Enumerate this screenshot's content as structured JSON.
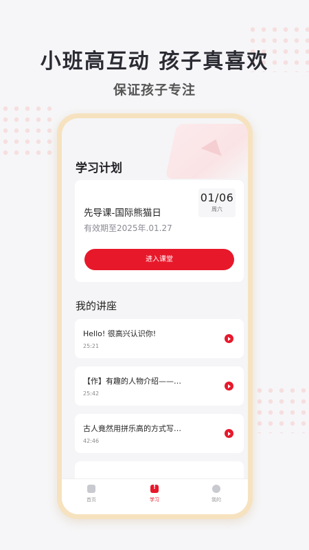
{
  "headline": "小班高互动 孩子真喜欢",
  "subline": "保证孩子专注",
  "app": {
    "plan_section_title": "学习计划",
    "plan": {
      "course_name": "先导课-国际熊猫日",
      "expire_text": "有效期至2025年.01.27",
      "date": "01/06",
      "weekday": "周六",
      "enter_label": "进入课堂"
    },
    "lecture_section_title": "我的讲座",
    "lectures": [
      {
        "title": "Hello! 很高兴认识你!",
        "duration": "25:21"
      },
      {
        "title": "【作】有趣的人物介绍——…",
        "duration": "25:42"
      },
      {
        "title": "古人竟然用拼乐高的方式写…",
        "duration": "42:46"
      },
      {
        "title": "",
        "duration": ""
      }
    ],
    "tabbar": [
      {
        "label": "首页",
        "icon": "home-icon"
      },
      {
        "label": "学习",
        "icon": "study-icon"
      },
      {
        "label": "我的",
        "icon": "profile-icon"
      }
    ]
  },
  "colors": {
    "accent": "#e8182b",
    "frame": "#f6e2bf",
    "background": "#f6f6f8"
  }
}
